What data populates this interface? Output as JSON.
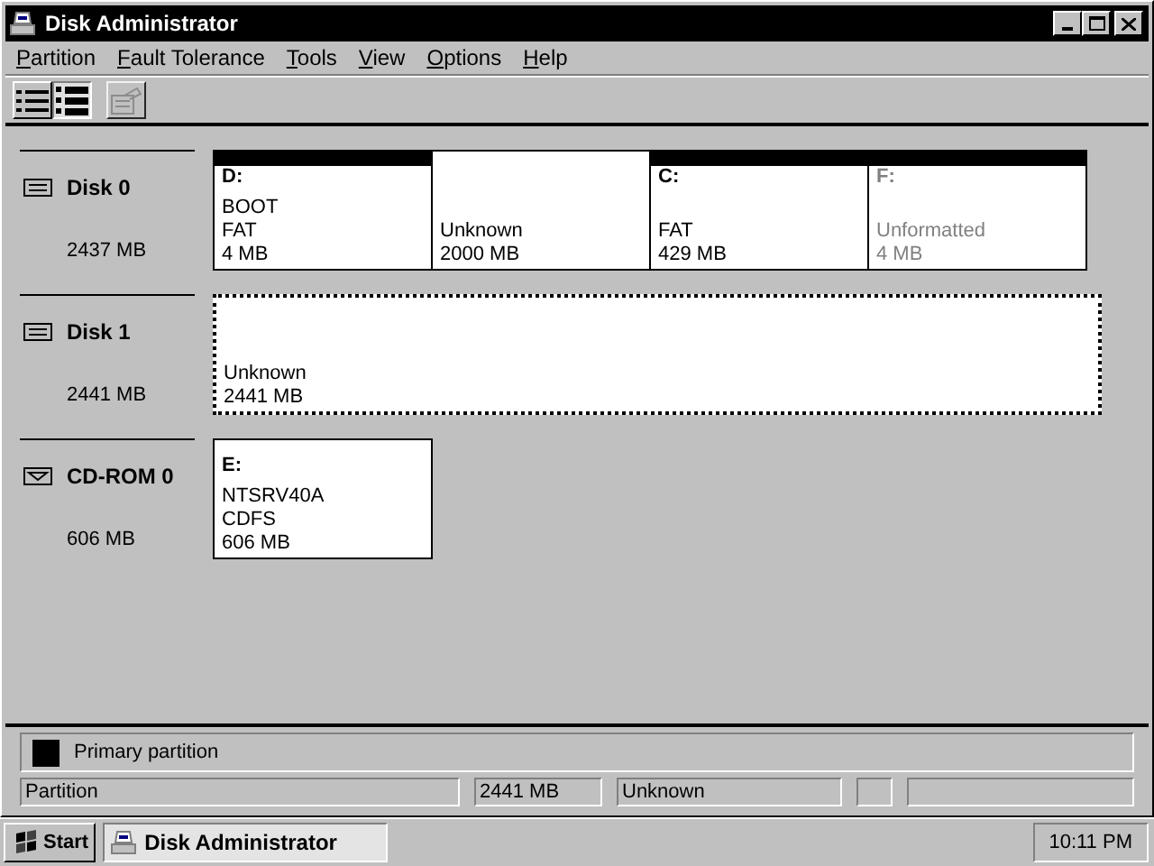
{
  "window": {
    "title": "Disk Administrator"
  },
  "menu": [
    {
      "label": "Partition",
      "mnemonic": true
    },
    {
      "label": "Fault Tolerance",
      "mnemonic": true
    },
    {
      "label": "Tools",
      "mnemonic": true
    },
    {
      "label": "View",
      "mnemonic": true
    },
    {
      "label": "Options",
      "mnemonic": true
    },
    {
      "label": "Help",
      "mnemonic": true
    }
  ],
  "toolbar": [
    {
      "kind": "list",
      "selected": false,
      "disabled": false
    },
    {
      "kind": "disks",
      "selected": true,
      "disabled": false
    },
    {
      "kind": "properties",
      "selected": false,
      "disabled": true
    }
  ],
  "disks": [
    {
      "kind": "hard_disk",
      "name": "Disk 0",
      "size": "2437 MB",
      "partitions": [
        {
          "label": "D:",
          "lines": [
            "BOOT",
            "FAT",
            "4 MB"
          ],
          "primary": true,
          "selected": false,
          "dimmed": false
        },
        {
          "lines": [
            "Unknown",
            "2000 MB"
          ],
          "primary": false,
          "selected": false,
          "dimmed": false
        },
        {
          "label": "C:",
          "lines": [
            "FAT",
            "429 MB"
          ],
          "primary": true,
          "selected": false,
          "dimmed": false
        },
        {
          "label": "F:",
          "lines": [
            "Unformatted",
            "4 MB"
          ],
          "primary": true,
          "selected": false,
          "dimmed": true
        }
      ]
    },
    {
      "kind": "hard_disk",
      "name": "Disk 1",
      "size": "2441 MB",
      "partitions": [
        {
          "lines": [
            "Unknown",
            "2441 MB"
          ],
          "primary": false,
          "selected": true,
          "dimmed": false
        }
      ]
    },
    {
      "kind": "cdrom",
      "name": "CD-ROM 0",
      "size": "606 MB",
      "partitions": [
        {
          "label": "E:",
          "lines": [
            "NTSRV40A",
            "CDFS",
            "606 MB"
          ],
          "primary": false,
          "selected": false,
          "dimmed": false
        }
      ]
    }
  ],
  "legend": [
    {
      "label": "Primary partition",
      "color": "#000000"
    }
  ],
  "status_bar": [
    "Partition",
    "2441 MB",
    "Unknown"
  ],
  "taskbar": {
    "start": "Start",
    "tasks": [
      {
        "label": "Disk Administrator",
        "selected": true
      }
    ],
    "clock": "10:11 PM"
  }
}
